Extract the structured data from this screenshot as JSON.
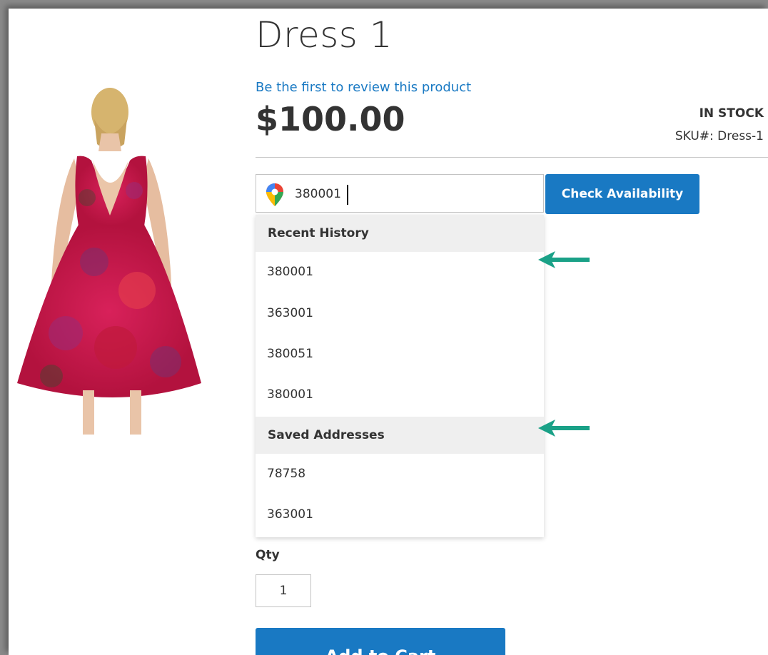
{
  "product": {
    "title": "Dress 1",
    "review_link": "Be the first to review this product",
    "price": "$100.00",
    "stock": "IN STOCK",
    "sku": "SKU#:  Dress-1",
    "image_alt": "Red floral sleeveless dress, back view"
  },
  "availability": {
    "zip_value": "380001",
    "pin_icon": "google-maps-pin-icon",
    "check_button": "Check Availability"
  },
  "dropdown": {
    "recent_header": "Recent History",
    "recent_items": [
      "380001",
      "363001",
      "380051",
      "380001"
    ],
    "saved_header": "Saved Addresses",
    "saved_items": [
      "78758",
      "363001"
    ]
  },
  "cart": {
    "qty_label": "Qty",
    "qty_value": "1",
    "add_button": "Add to Cart"
  },
  "colors": {
    "accent": "#1979c3",
    "annotation_arrow": "#1aa187"
  }
}
